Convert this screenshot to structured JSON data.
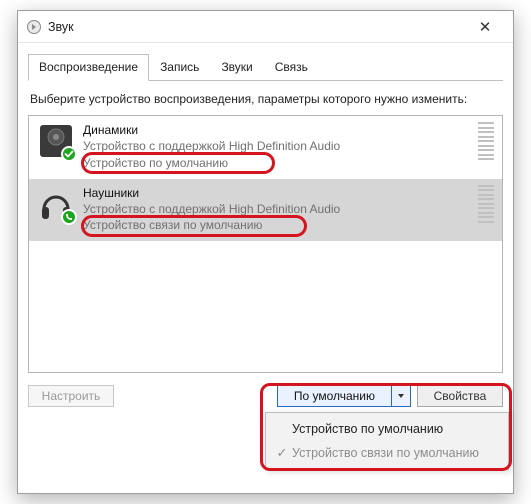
{
  "window": {
    "title": "Звук"
  },
  "tabs": [
    "Воспроизведение",
    "Запись",
    "Звуки",
    "Связь"
  ],
  "instruction": "Выберите устройство воспроизведения, параметры которого нужно изменить:",
  "devices": [
    {
      "name": "Динамики",
      "driver": "Устройство с поддержкой High Definition Audio",
      "status": "Устройство по умолчанию",
      "badge": "check",
      "selected": false
    },
    {
      "name": "Наушники",
      "driver": "Устройство с поддержкой High Definition Audio",
      "status": "Устройство связи по умолчанию",
      "badge": "phone",
      "selected": true
    }
  ],
  "buttons": {
    "configure": "Настроить",
    "default": "По умолчанию",
    "properties": "Свойства"
  },
  "menu": {
    "item1": "Устройство по умолчанию",
    "item2": "Устройство связи по умолчанию"
  }
}
